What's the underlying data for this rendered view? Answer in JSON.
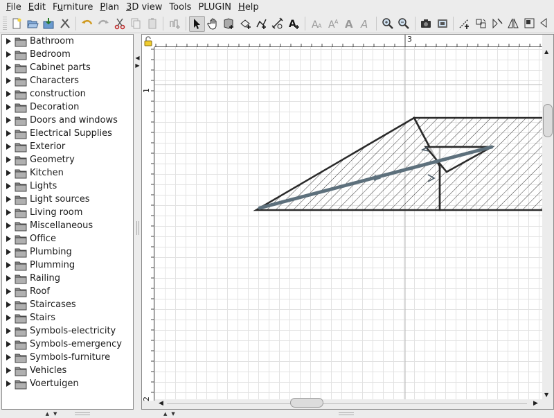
{
  "menu": [
    {
      "label": "File",
      "mnemonic": "F"
    },
    {
      "label": "Edit",
      "mnemonic": "E"
    },
    {
      "label": "Furniture",
      "mnemonic": "u"
    },
    {
      "label": "Plan",
      "mnemonic": "P"
    },
    {
      "label": "3D view",
      "mnemonic": "3"
    },
    {
      "label": "Tools",
      "mnemonic": ""
    },
    {
      "label": "PLUGIN",
      "mnemonic": ""
    },
    {
      "label": "Help",
      "mnemonic": "H"
    }
  ],
  "toolbar": {
    "buttons": [
      "new-home-icon",
      "open-icon",
      "save-icon",
      "preferences-icon",
      "undo-icon",
      "redo-icon",
      "cut-icon",
      "copy-icon",
      "paste-icon",
      "add-furniture-icon",
      "select-icon",
      "pan-icon",
      "create-walls-icon",
      "create-rooms-icon",
      "create-polylines-icon",
      "create-dimensions-icon",
      "add-text-icon",
      "text-style-icon",
      "text-bold-icon",
      "text-italic-icon",
      "text-size-icon",
      "zoom-in-icon",
      "zoom-out-icon",
      "create-photo-icon",
      "create-video-icon",
      "flip-icon",
      "rotate-icon",
      "mirror-icon",
      "plugin-icon"
    ],
    "active": "select-icon"
  },
  "catalog": {
    "categories": [
      "Bathroom",
      "Bedroom",
      "Cabinet parts",
      "Characters",
      "construction",
      "Decoration",
      "Doors and windows",
      "Electrical Supplies",
      "Exterior",
      "Geometry",
      "Kitchen",
      "Lights",
      "Light sources",
      "Living room",
      "Miscellaneous",
      "Office",
      "Plumbing",
      "Plumming",
      "Railing",
      "Roof",
      "Staircases",
      "Stairs",
      "Symbols-electricity",
      "Symbols-emergency",
      "Symbols-furniture",
      "Vehicles",
      "Voertuigen"
    ]
  },
  "plan": {
    "ruler_top_label": "3",
    "ruler_left_label_1": "1",
    "ruler_left_label_2": "2"
  },
  "colors": {
    "wall_outline": "#2a2a2a",
    "hatch": "#3a3a3a",
    "polyline": "#5d707c",
    "grid": "#e2e2e2"
  }
}
